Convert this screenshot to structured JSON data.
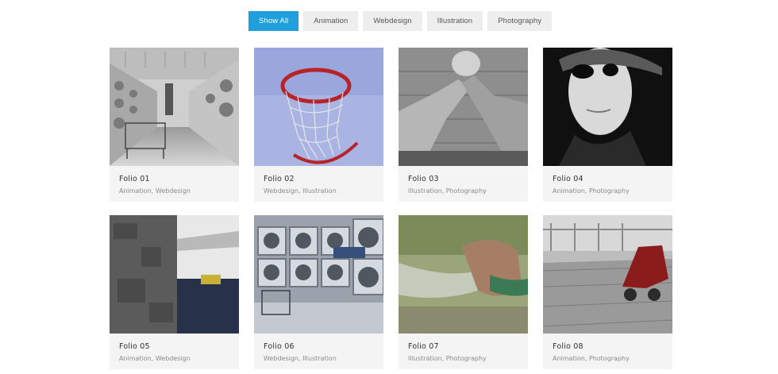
{
  "filters": {
    "show_all": "Show All",
    "animation": "Animation",
    "webdesign": "Webdesign",
    "illustration": "Illustration",
    "photography": "Photography"
  },
  "portfolio": {
    "items": [
      {
        "title": "Folio 01",
        "categories": "Animation, Webdesign",
        "image": "laundromat-photo"
      },
      {
        "title": "Folio 02",
        "categories": "Webdesign, Illustration",
        "image": "basketball-hoop-photo"
      },
      {
        "title": "Folio 03",
        "categories": "Illustration, Photography",
        "image": "arm-wrestling-photo"
      },
      {
        "title": "Folio 04",
        "categories": "Animation, Photography",
        "image": "sunglasses-portrait-photo"
      },
      {
        "title": "Folio 05",
        "categories": "Animation, Webdesign",
        "image": "wall-jeans-photo"
      },
      {
        "title": "Folio 06",
        "categories": "Webdesign, Illustration",
        "image": "laundry-machines-photo"
      },
      {
        "title": "Folio 07",
        "categories": "Illustration, Photography",
        "image": "garden-hose-photo"
      },
      {
        "title": "Folio 08",
        "categories": "Animation, Photography",
        "image": "roller-skates-photo"
      }
    ]
  }
}
